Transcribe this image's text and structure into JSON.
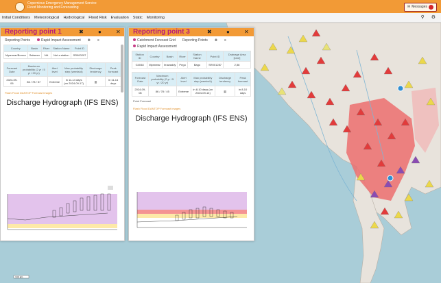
{
  "header": {
    "title_line1": "Copernicus Emergency Management Service",
    "title_line2": "Flood Monitoring and Forecasting",
    "messages_label": "Messages"
  },
  "nav": {
    "tabs": [
      "Initial Conditions",
      "Meteorological",
      "Hydrological",
      "Flood Risk",
      "Evaluation",
      "Static",
      "Monitoring"
    ]
  },
  "panel1": {
    "title": "Reporting point 1",
    "links": [
      "Reporting Points",
      "Rapid Impact Assessment"
    ],
    "info_headers": [
      "Country",
      "Basin",
      "River",
      "Station Name",
      "Point ID"
    ],
    "info_row": [
      "Myanmar/Burma",
      "Salween",
      "NA",
      "Not a station",
      "SR000207"
    ],
    "fc_headers": [
      "Forecast Date",
      "Maximum probability (2 yr / 5 yr / 20 yr)",
      "Alert level",
      "Max probability step (weeks/d)",
      "Discharge tendency",
      "Peak forecast"
    ],
    "fc_row": [
      "2024-09-06",
      "86 / 78 / 57",
      "Extreme",
      "in 11-14 days (on 2024-09-17)",
      "",
      "in 11-14 days"
    ],
    "ff_link": "Flash Flood DANTOP Forecast images",
    "hydro_title": "Discharge Hydrograph (IFS ENS)"
  },
  "panel2": {
    "title": "Reporting point 3",
    "links": [
      "Catchment Forecast Grid",
      "Reporting Points",
      "Rapid Impact Assessment"
    ],
    "info_headers": [
      "Station ID",
      "Country",
      "Basin",
      "River",
      "Station Name",
      "Point ID",
      "Drainage Area [km2]"
    ],
    "info_row": [
      "G4048",
      "Myanmar",
      "Irrawaddy",
      "Pegu",
      "Bago",
      "SR001287",
      "2,58"
    ],
    "fc_headers": [
      "Forecast Date",
      "Maximum probability (2 yr / 5 yr / 20 yr)",
      "Alert level",
      "Max probability step (weeks/d)",
      "Discharge tendency",
      "Peak forecast"
    ],
    "fc_row": [
      "2024-09-06",
      "86 / 78 / 45",
      "Extreme",
      "in 8-10 days (on 2024-09-14)",
      "",
      "in 8-10 days"
    ],
    "section": "Point Forecast",
    "ff_link": "Flash Flood DANTOP Forecast images",
    "hydro_title": "Discharge Hydrograph (IFS ENS)"
  },
  "footer": {
    "scale": "100 km"
  }
}
